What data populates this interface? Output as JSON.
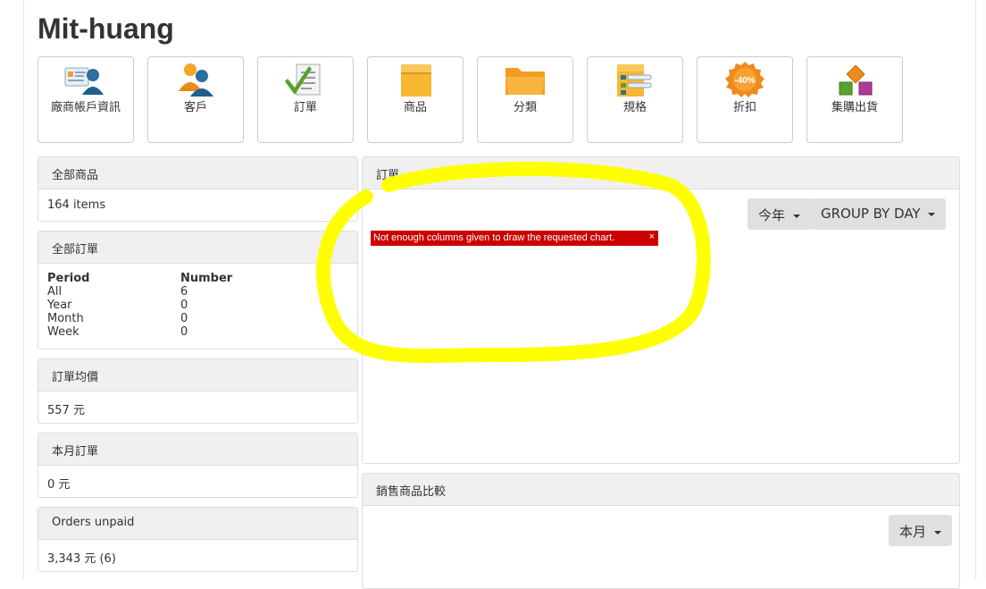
{
  "header": {
    "title": "Mit-huang"
  },
  "nav_tiles": [
    {
      "label": "廠商帳戶資訊",
      "icon": "vendor-account-icon"
    },
    {
      "label": "客戶",
      "icon": "customers-icon"
    },
    {
      "label": "訂單",
      "icon": "orders-icon"
    },
    {
      "label": "商品",
      "icon": "products-box-icon"
    },
    {
      "label": "分類",
      "icon": "categories-folder-icon"
    },
    {
      "label": "規格",
      "icon": "specs-icon"
    },
    {
      "label": "折扣",
      "icon": "discount-badge-icon",
      "badge_text": "-40%"
    },
    {
      "label": "集購出貨",
      "icon": "group-shipping-icon"
    }
  ],
  "all_products": {
    "title": "全部商品",
    "value": "164 items"
  },
  "all_orders": {
    "title": "全部訂單",
    "columns": [
      "Period",
      "Number"
    ],
    "rows": [
      [
        "All",
        "6"
      ],
      [
        "Year",
        "0"
      ],
      [
        "Month",
        "0"
      ],
      [
        "Week",
        "0"
      ]
    ]
  },
  "avg_order": {
    "title": "訂單均價",
    "value": "557 元"
  },
  "month_orders": {
    "title": "本月訂單",
    "value": "0 元"
  },
  "orders_unpaid": {
    "title": "Orders unpaid",
    "value": "3,343 元 (6)"
  },
  "orders_chart": {
    "title": "訂單",
    "period_dropdown": "今年",
    "group_dropdown": "GROUP BY DAY",
    "error_message": "Not enough columns given to draw the requested chart.",
    "error_close": "×"
  },
  "sales_compare": {
    "title": "銷售商品比較",
    "period_dropdown": "本月"
  },
  "colors": {
    "panel_header_bg": "#f0f0f0",
    "error_bg": "#cc0000",
    "highlight": "#ffff00"
  }
}
